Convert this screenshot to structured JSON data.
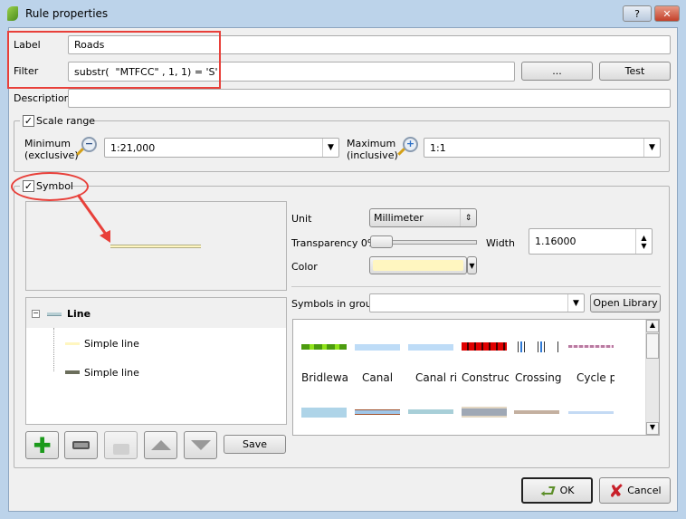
{
  "window": {
    "title": "Rule properties",
    "help_label": "?",
    "close_label": "✕"
  },
  "form": {
    "label_label": "Label",
    "label_value": "Roads",
    "filter_label": "Filter",
    "filter_value": "substr(  \"MTFCC\" , 1, 1) = 'S'",
    "expression_button": "...",
    "test_button": "Test",
    "description_label": "Description",
    "description_value": ""
  },
  "scale_range": {
    "title": "Scale range",
    "checked": true,
    "minimum_label_1": "Minimum",
    "minimum_label_2": "(exclusive)",
    "minimum_value": "1:21,000",
    "maximum_label_1": "Maximum",
    "maximum_label_2": "(inclusive)",
    "maximum_value": "1:1"
  },
  "symbol": {
    "title": "Symbol",
    "checked": true,
    "unit_label": "Unit",
    "unit_value": "Millimeter",
    "transparency_label": "Transparency 0%",
    "transparency_percent": 0,
    "width_label": "Width",
    "width_value": "1.16000",
    "color_label": "Color",
    "color_value": "#fff6c0",
    "symbols_in_group_label": "Symbols in group",
    "symbols_in_group_value": "",
    "open_library_button": "Open Library",
    "tree": {
      "root": "Line",
      "children": [
        {
          "label": "Simple line",
          "color": "#fff6c0"
        },
        {
          "label": "Simple line",
          "color": "#6b6e5c"
        }
      ]
    },
    "library": [
      "Bridleway",
      "Canal",
      "Canal ri",
      "Construc",
      "Crossing",
      "Cycle p"
    ],
    "save_button": "Save"
  },
  "footer": {
    "ok_button": "OK",
    "cancel_button": "Cancel"
  },
  "annotations": {
    "highlight_color": "#e8403a"
  }
}
